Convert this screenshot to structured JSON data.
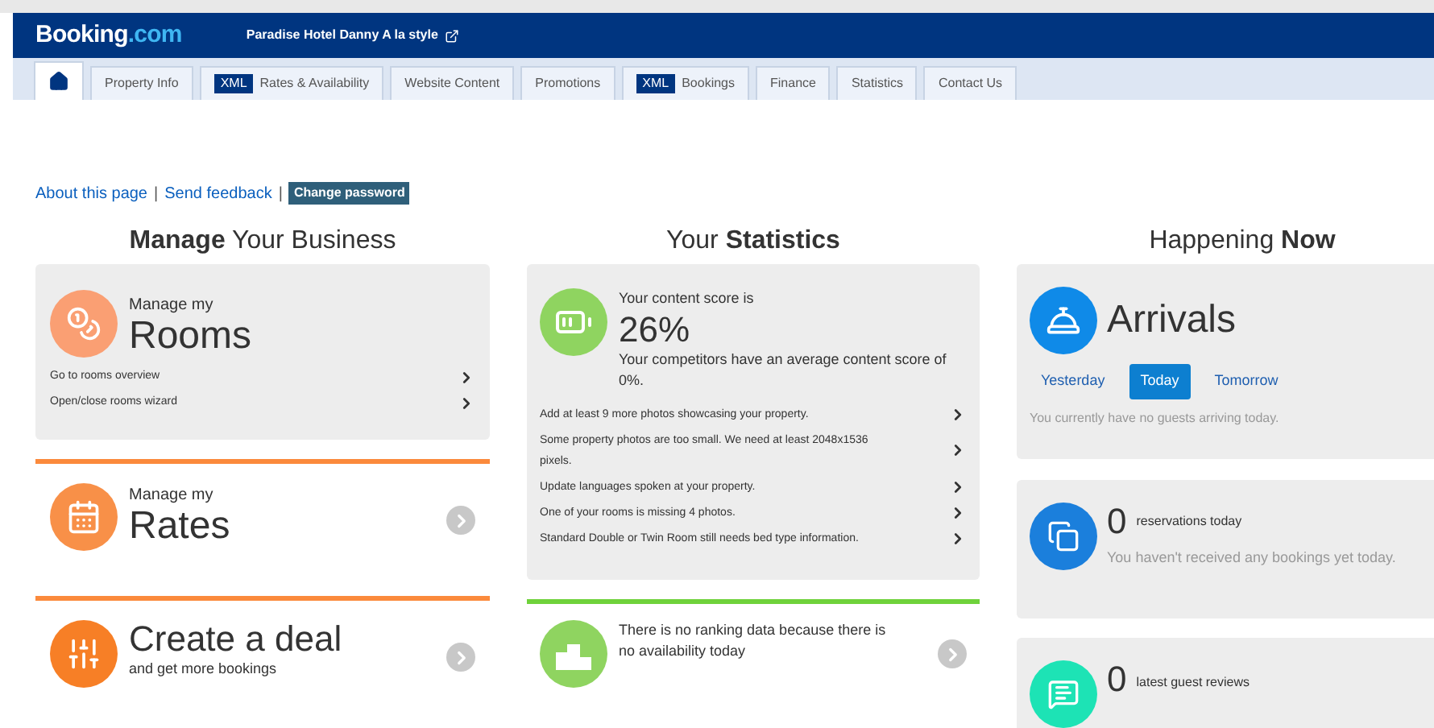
{
  "header": {
    "logo": {
      "main": "Booking",
      "suffix": ".com"
    },
    "hotel_name": "Paradise Hotel Danny A la style"
  },
  "tabs": [
    {
      "kind": "home",
      "selected": true
    },
    {
      "kind": "tab",
      "label": "Property Info",
      "selected": false
    },
    {
      "kind": "tab",
      "badge": "XML",
      "label": "Rates & Availability",
      "selected": false
    },
    {
      "kind": "tab",
      "label": "Website Content",
      "selected": false
    },
    {
      "kind": "tab",
      "label": "Promotions",
      "selected": false
    },
    {
      "kind": "tab",
      "badge": "XML",
      "label": "Bookings",
      "selected": false
    },
    {
      "kind": "tab",
      "label": "Finance",
      "selected": false
    },
    {
      "kind": "tab",
      "label": "Statistics",
      "selected": false
    },
    {
      "kind": "tab",
      "label": "Contact Us",
      "selected": false
    }
  ],
  "links": [
    {
      "kind": "link",
      "text": "About this page"
    },
    {
      "kind": "separator",
      "text": "|"
    },
    {
      "kind": "link",
      "text": "Send feedback"
    },
    {
      "kind": "separator",
      "text": "|"
    },
    {
      "kind": "button",
      "text": "Change password"
    }
  ],
  "business": {
    "title": "**Manage** Your Business",
    "rooms": {
      "kicker": "Manage my",
      "title": "Rooms",
      "links": [
        "Go to rooms overview",
        "Open/close rooms wizard"
      ]
    },
    "rates": {
      "kicker": "Manage my",
      "title": "Rates"
    },
    "deal": {
      "title": "Create a deal",
      "subtitle": "and get more bookings"
    }
  },
  "statistics": {
    "title": "Your **Statistics**",
    "kicker": "Your content score is",
    "score": "26%",
    "comparison": "Your competitors have an average content score of 0%.",
    "tips": [
      "Add at least 9 more photos showcasing your property.",
      "Some property photos are too small. We need at least 2048x1536 pixels.",
      "Update languages spoken at your property.",
      "One of your rooms is missing 4 photos.",
      "Standard Double or Twin Room still needs bed type information."
    ],
    "ranking": "There is no ranking data because there is no availability today"
  },
  "happening": {
    "title": "Happening **Now**",
    "arrivals": {
      "title": "Arrivals",
      "days": [
        {
          "label": "Yesterday",
          "selected": false
        },
        {
          "label": "Today",
          "selected": true
        },
        {
          "label": "Tomorrow",
          "selected": false
        }
      ],
      "message": "You currently have no guests arriving today."
    },
    "reservations": {
      "count": "0",
      "label": "reservations today",
      "message": "You haven't received any bookings yet today."
    },
    "reviews": {
      "count": "0",
      "label": "latest guest reviews"
    }
  }
}
